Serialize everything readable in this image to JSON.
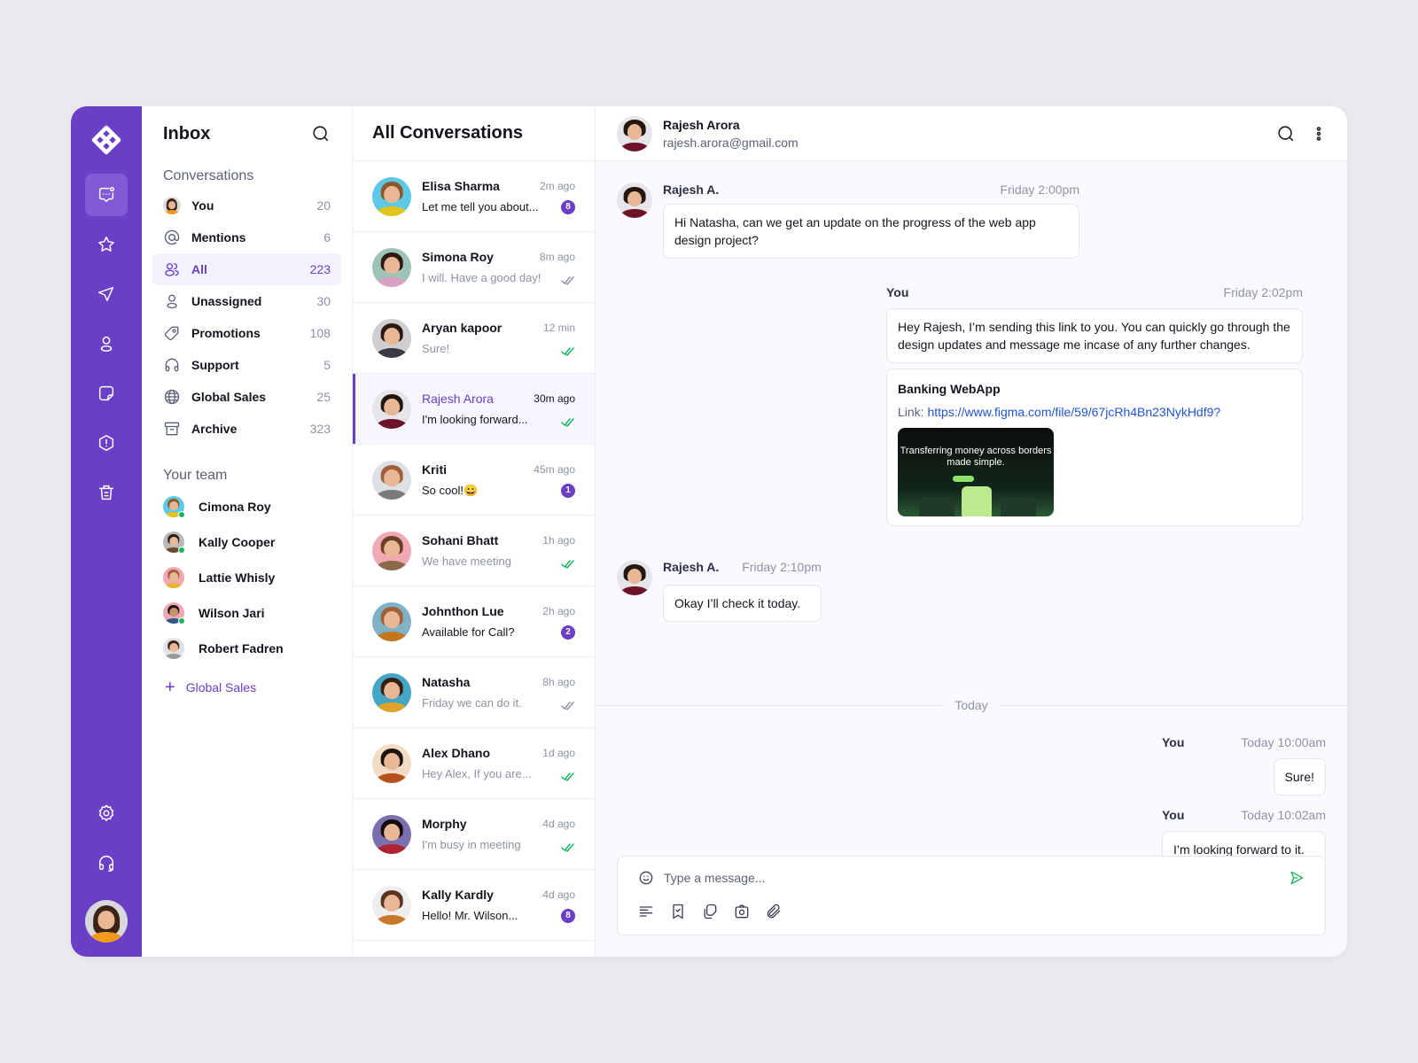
{
  "colors": {
    "brand": "#6a3fc6",
    "online": "#1bb35e",
    "link": "#1f55d6",
    "read_tick": "#1bb35e",
    "sent_tick": "#8d93a6"
  },
  "rail": {
    "logo": "app-logo-icon",
    "items": [
      {
        "icon": "chat-icon",
        "active": true
      },
      {
        "icon": "star-icon"
      },
      {
        "icon": "send-icon"
      },
      {
        "icon": "user-icon"
      },
      {
        "icon": "note-icon"
      },
      {
        "icon": "alert-icon"
      },
      {
        "icon": "trash-icon"
      }
    ],
    "bottom": [
      {
        "icon": "settings-icon"
      },
      {
        "icon": "headset-icon"
      }
    ],
    "avatar": "current-user-avatar"
  },
  "inbox": {
    "title": "Inbox",
    "conversations_heading": "Conversations",
    "items": [
      {
        "label": "You",
        "count": "20",
        "icon": "avatar"
      },
      {
        "label": "Mentions",
        "count": "6",
        "icon": "at-icon"
      },
      {
        "label": "All",
        "count": "223",
        "icon": "users-icon",
        "active": true
      },
      {
        "label": "Unassigned",
        "count": "30",
        "icon": "user-icon"
      },
      {
        "label": "Promotions",
        "count": "108",
        "icon": "tag-icon"
      },
      {
        "label": "Support",
        "count": "5",
        "icon": "headset-icon"
      },
      {
        "label": "Global Sales",
        "count": "25",
        "icon": "globe-icon"
      },
      {
        "label": "Archive",
        "count": "323",
        "icon": "archive-icon"
      }
    ],
    "team_heading": "Your team",
    "team": [
      {
        "name": "Cimona Roy",
        "online": true
      },
      {
        "name": "Kally Cooper",
        "online": true
      },
      {
        "name": "Lattie Whisly",
        "online": false
      },
      {
        "name": "Wilson Jari",
        "online": true
      },
      {
        "name": "Robert Fadren",
        "online": false
      }
    ],
    "add_team_label": "Global Sales"
  },
  "conversations": {
    "title": "All Conversations",
    "items": [
      {
        "name": "Elisa Sharma",
        "time": "2m ago",
        "preview": "Let me tell you about...",
        "unread": "8",
        "status": "badge"
      },
      {
        "name": "Simona Roy",
        "time": "8m ago",
        "preview": "I will. Have a good day!",
        "status": "sent"
      },
      {
        "name": "Aryan kapoor",
        "time": "12 min",
        "preview": "Sure!",
        "status": "read"
      },
      {
        "name": "Rajesh Arora",
        "time": "30m ago",
        "preview": "I'm looking forward...",
        "status": "read",
        "active": true
      },
      {
        "name": "Kriti",
        "time": "45m ago",
        "preview": "So cool!😀",
        "unread": "1",
        "status": "badge"
      },
      {
        "name": "Sohani Bhatt",
        "time": "1h ago",
        "preview": "We have meeting",
        "status": "read"
      },
      {
        "name": "Johnthon Lue",
        "time": "2h ago",
        "preview": "Available for Call?",
        "unread": "2",
        "status": "badge"
      },
      {
        "name": "Natasha",
        "time": "8h ago",
        "preview": "Friday we can do it.",
        "status": "sent"
      },
      {
        "name": "Alex Dhano",
        "time": "1d ago",
        "preview": "Hey Alex, If you are...",
        "status": "read"
      },
      {
        "name": "Morphy",
        "time": "4d ago",
        "preview": "I'm busy in meeting",
        "status": "read"
      },
      {
        "name": "Kally Kardly",
        "time": "4d ago",
        "preview": "Hello! Mr. Wilson...",
        "unread": "8",
        "status": "badge"
      }
    ]
  },
  "chat": {
    "contact_name": "Rajesh Arora",
    "contact_email": "rajesh.arora@gmail.com",
    "messages": [
      {
        "sender": "Rajesh A.",
        "time": "Friday 2:00pm",
        "text": "Hi Natasha, can we get an update on the progress of the web app design project?"
      },
      {
        "sender": "You",
        "time": "Friday 2:02pm",
        "text": "Hey Rajesh, I’m sending this link to you. You can quickly go through the design updates and message me incase of any further changes.",
        "attachment": {
          "title": "Banking WebApp",
          "link_label": "Link:",
          "url": "https://www.figma.com/file/59/67jcRh4Bn23NykHdf9?",
          "preview_text": "Transferring money across borders made simple."
        }
      },
      {
        "sender": "Rajesh A.",
        "time": "Friday 2:10pm",
        "text": "Okay I’ll check it today."
      },
      {
        "sender": "You",
        "time": "Today 10:00am",
        "text": "Sure!"
      },
      {
        "sender": "You",
        "time": "Today 10:02am",
        "text": "I’m looking forward to it."
      }
    ],
    "divider": "Today",
    "composer": {
      "placeholder": "Type a message...",
      "tools": [
        "text-format-icon",
        "bookmark-icon",
        "sticker-icon",
        "camera-icon",
        "attachment-icon"
      ]
    }
  }
}
